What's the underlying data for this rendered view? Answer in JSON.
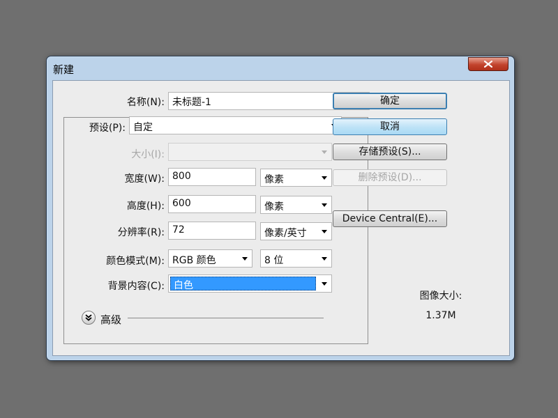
{
  "dialog": {
    "title": "新建"
  },
  "form": {
    "name_label": "名称(N):",
    "name_value": "未标题-1",
    "preset_label": "预设(P):",
    "preset_value": "自定",
    "size_label": "大小(I):",
    "size_value": "",
    "width_label": "宽度(W):",
    "width_value": "800",
    "width_unit": "像素",
    "height_label": "高度(H):",
    "height_value": "600",
    "height_unit": "像素",
    "resolution_label": "分辨率(R):",
    "resolution_value": "72",
    "resolution_unit": "像素/英寸",
    "color_mode_label": "颜色模式(M):",
    "color_mode_value": "RGB 颜色",
    "bit_depth_value": "8 位",
    "background_label": "背景内容(C):",
    "background_value": "白色",
    "advanced_label": "高级"
  },
  "buttons": {
    "ok": "确定",
    "cancel": "取消",
    "save_preset": "存储预设(S)...",
    "delete_preset": "删除预设(D)...",
    "device_central": "Device Central(E)..."
  },
  "info": {
    "image_size_label": "图像大小:",
    "image_size_value": "1.37M"
  },
  "icons": {
    "close": "close-icon",
    "advanced": "double-chevron-down-icon"
  },
  "colors": {
    "selection": "#3399ff",
    "title_bar": "#bcd3ea",
    "close_button": "#c2432c"
  }
}
